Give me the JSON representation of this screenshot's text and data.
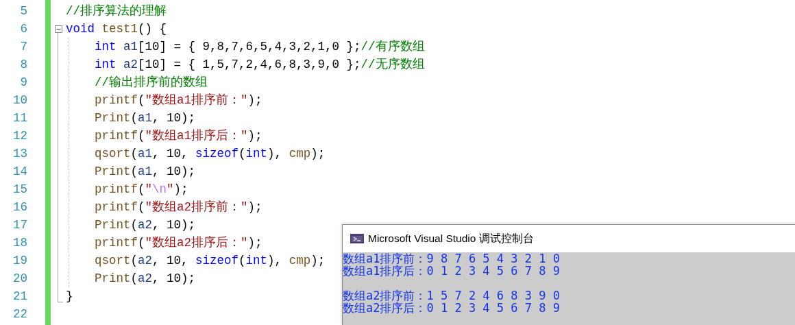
{
  "editor": {
    "lines": [
      {
        "number": "5",
        "tokens": [
          {
            "kind": "comment",
            "text": "//排序算法的理解"
          }
        ]
      },
      {
        "number": "6",
        "tokens": [
          {
            "kind": "keyword",
            "text": "void"
          },
          {
            "kind": "func",
            "text": " test1"
          },
          {
            "kind": "plain",
            "text": "() {"
          }
        ],
        "expanded": true,
        "children": [
          {
            "number": "7",
            "tokens": [
              {
                "kind": "keyword",
                "text": "int"
              },
              {
                "kind": "var",
                "text": " a1"
              },
              {
                "kind": "plain",
                "text": "[10] = { 9,8,7,6,5,4,3,2,1,0 };"
              },
              {
                "kind": "comment",
                "text": "//有序数组"
              }
            ]
          },
          {
            "number": "8",
            "tokens": [
              {
                "kind": "keyword",
                "text": "int"
              },
              {
                "kind": "var",
                "text": " a2"
              },
              {
                "kind": "plain",
                "text": "[10] = { 1,5,7,2,4,6,8,3,9,0 };"
              },
              {
                "kind": "comment",
                "text": "//无序数组"
              }
            ]
          },
          {
            "number": "9",
            "tokens": [
              {
                "kind": "comment",
                "text": "//输出排序前的数组"
              }
            ]
          },
          {
            "number": "10",
            "tokens": [
              {
                "kind": "func",
                "text": "printf"
              },
              {
                "kind": "plain",
                "text": "("
              },
              {
                "kind": "string",
                "text": "\"数组a1排序前：\""
              },
              {
                "kind": "plain",
                "text": ");"
              }
            ]
          },
          {
            "number": "11",
            "tokens": [
              {
                "kind": "func",
                "text": "Print"
              },
              {
                "kind": "plain",
                "text": "("
              },
              {
                "kind": "var",
                "text": "a1"
              },
              {
                "kind": "plain",
                "text": ", 10);"
              }
            ]
          },
          {
            "number": "12",
            "tokens": [
              {
                "kind": "func",
                "text": "printf"
              },
              {
                "kind": "plain",
                "text": "("
              },
              {
                "kind": "string",
                "text": "\"数组a1排序后：\""
              },
              {
                "kind": "plain",
                "text": ");"
              }
            ]
          },
          {
            "number": "13",
            "tokens": [
              {
                "kind": "func",
                "text": "qsort"
              },
              {
                "kind": "plain",
                "text": "("
              },
              {
                "kind": "var",
                "text": "a1"
              },
              {
                "kind": "plain",
                "text": ", 10, "
              },
              {
                "kind": "keyword",
                "text": "sizeof"
              },
              {
                "kind": "plain",
                "text": "("
              },
              {
                "kind": "keyword",
                "text": "int"
              },
              {
                "kind": "plain",
                "text": "), "
              },
              {
                "kind": "func",
                "text": "cmp"
              },
              {
                "kind": "plain",
                "text": ");"
              }
            ]
          },
          {
            "number": "14",
            "tokens": [
              {
                "kind": "func",
                "text": "Print"
              },
              {
                "kind": "plain",
                "text": "("
              },
              {
                "kind": "var",
                "text": "a1"
              },
              {
                "kind": "plain",
                "text": ", 10);"
              }
            ]
          },
          {
            "number": "15",
            "tokens": [
              {
                "kind": "func",
                "text": "printf"
              },
              {
                "kind": "plain",
                "text": "("
              },
              {
                "kind": "string",
                "text": "\""
              },
              {
                "kind": "escape",
                "text": "\\n"
              },
              {
                "kind": "string",
                "text": "\""
              },
              {
                "kind": "plain",
                "text": ");"
              }
            ]
          },
          {
            "number": "16",
            "tokens": [
              {
                "kind": "func",
                "text": "printf"
              },
              {
                "kind": "plain",
                "text": "("
              },
              {
                "kind": "string",
                "text": "\"数组a2排序前：\""
              },
              {
                "kind": "plain",
                "text": ");"
              }
            ]
          },
          {
            "number": "17",
            "tokens": [
              {
                "kind": "func",
                "text": "Print"
              },
              {
                "kind": "plain",
                "text": "("
              },
              {
                "kind": "var",
                "text": "a2"
              },
              {
                "kind": "plain",
                "text": ", 10);"
              }
            ]
          },
          {
            "number": "18",
            "tokens": [
              {
                "kind": "func",
                "text": "printf"
              },
              {
                "kind": "plain",
                "text": "("
              },
              {
                "kind": "string",
                "text": "\"数组a2排序后：\""
              },
              {
                "kind": "plain",
                "text": ");"
              }
            ]
          },
          {
            "number": "19",
            "tokens": [
              {
                "kind": "func",
                "text": "qsort"
              },
              {
                "kind": "plain",
                "text": "("
              },
              {
                "kind": "var",
                "text": "a2"
              },
              {
                "kind": "plain",
                "text": ", 10, "
              },
              {
                "kind": "keyword",
                "text": "sizeof"
              },
              {
                "kind": "plain",
                "text": "("
              },
              {
                "kind": "keyword",
                "text": "int"
              },
              {
                "kind": "plain",
                "text": "), "
              },
              {
                "kind": "func",
                "text": "cmp"
              },
              {
                "kind": "plain",
                "text": ");"
              }
            ]
          },
          {
            "number": "20",
            "tokens": [
              {
                "kind": "func",
                "text": "Print"
              },
              {
                "kind": "plain",
                "text": "("
              },
              {
                "kind": "var",
                "text": "a2"
              },
              {
                "kind": "plain",
                "text": ", 10);"
              }
            ]
          }
        ],
        "closing": {
          "number": "21",
          "tokens": [
            {
              "kind": "plain",
              "text": "}"
            }
          ]
        }
      },
      {
        "number": "22"
      }
    ]
  },
  "console": {
    "title": "Microsoft Visual Studio 调试控制台",
    "blocks": [
      [
        "数组a1排序前：9 8 7 6 5 4 3 2 1 0",
        "数组a1排序后：0 1 2 3 4 5 6 7 8 9"
      ],
      [
        "数组a2排序前：1 5 7 2 4 6 8 3 9 0",
        "数组a2排序后：0 1 2 3 4 5 6 7 8 9"
      ]
    ]
  }
}
